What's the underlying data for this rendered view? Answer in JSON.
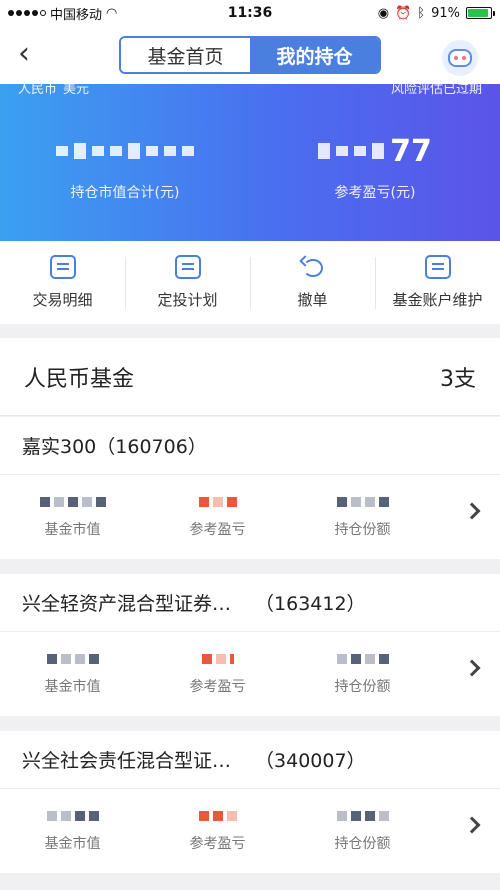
{
  "status": {
    "carrier": "中国移动",
    "time": "11:36",
    "battery": "91%",
    "battery_level": 0.91
  },
  "nav": {
    "tab_home": "基金首页",
    "tab_holdings": "我的持仓"
  },
  "hero": {
    "currency_rmb": "人民币",
    "currency_usd": "美元",
    "risk_note": "风险评估已过期",
    "market_value_label": "持仓市值合计(元)",
    "profit_label": "参考盈亏(元)",
    "profit_visible_digits": "77"
  },
  "actions": [
    {
      "label": "交易明细",
      "icon": "document-icon"
    },
    {
      "label": "定投计划",
      "icon": "document-icon"
    },
    {
      "label": "撤单",
      "icon": "undo-icon"
    },
    {
      "label": "基金账户维护",
      "icon": "document-icon"
    }
  ],
  "section": {
    "title": "人民币基金",
    "count": "3支"
  },
  "stat_labels": {
    "market_value": "基金市值",
    "profit": "参考盈亏",
    "shares": "持仓份额"
  },
  "funds": [
    {
      "name": "嘉实300",
      "code": "（160706）"
    },
    {
      "name": "兴全轻资产混合型证券…",
      "code": "（163412）"
    },
    {
      "name": "兴全社会责任混合型证…",
      "code": "（340007）"
    }
  ],
  "colors": {
    "accent": "#4a7fe0",
    "profit_red": "#e8593a"
  }
}
